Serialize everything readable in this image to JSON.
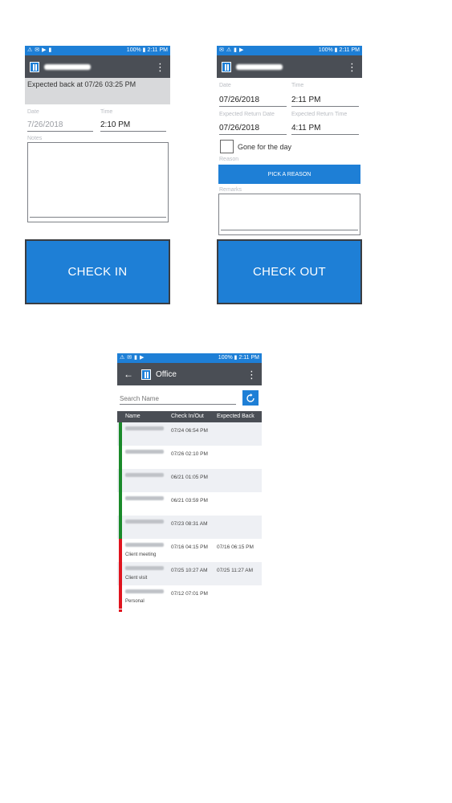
{
  "screens": {
    "check_in": {
      "status": {
        "right": "100% ▮ 2:11 PM"
      },
      "banner": "Expected back at 07/26 03:25 PM",
      "date_label": "Date",
      "date_value": "7/26/2018",
      "time_label": "Time",
      "time_value": "2:10 PM",
      "notes_label": "Notes",
      "button_label": "CHECK IN"
    },
    "check_out": {
      "status": {
        "right": "100% ▮ 2:11 PM"
      },
      "date_label": "Date",
      "date_value": "07/26/2018",
      "time_label": "Time",
      "time_value": "2:11 PM",
      "exp_date_label": "Expected Return Date",
      "exp_date_value": "07/26/2018",
      "exp_time_label": "Expected Return Time",
      "exp_time_value": "4:11 PM",
      "gone_label": "Gone for the day",
      "reason_label": "Reason",
      "reason_button": "PICK A REASON",
      "remarks_label": "Remarks",
      "button_label": "CHECK OUT"
    },
    "office": {
      "status": {
        "right": "100% ▮ 2:11 PM"
      },
      "title": "Office",
      "search_placeholder": "Search Name",
      "columns": [
        "Name",
        "Check In/Out",
        "Expected Back"
      ],
      "rows": [
        {
          "status": "in",
          "check": "07/24 06:54 PM",
          "expected": "",
          "note": ""
        },
        {
          "status": "in",
          "check": "07/26 02:10 PM",
          "expected": "",
          "note": ""
        },
        {
          "status": "in",
          "check": "06/21 01:05 PM",
          "expected": "",
          "note": ""
        },
        {
          "status": "in",
          "check": "06/21 03:59 PM",
          "expected": "",
          "note": ""
        },
        {
          "status": "in",
          "check": "07/23 08:31 AM",
          "expected": "",
          "note": ""
        },
        {
          "status": "out",
          "check": "07/16 04:15 PM",
          "expected": "07/16 06:15 PM",
          "note": "Client meeting"
        },
        {
          "status": "out",
          "check": "07/25 10:27 AM",
          "expected": "07/25 11:27 AM",
          "note": "Client visit"
        },
        {
          "status": "out",
          "check": "07/12 07:01 PM",
          "expected": "",
          "note": "Personal"
        }
      ]
    }
  },
  "colors": {
    "accent": "#1e7fd6",
    "appbar": "#4a4e55",
    "in": "#1a8a2a",
    "out": "#e0141e"
  }
}
